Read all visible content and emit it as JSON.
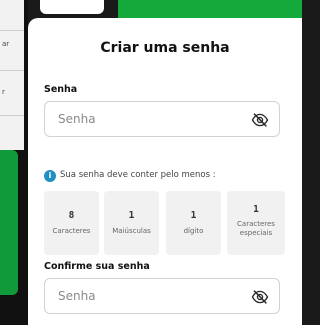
{
  "background": {
    "left_texts": [
      "ar",
      "r"
    ]
  },
  "sheet": {
    "title": "Criar uma senha",
    "password": {
      "label": "Senha",
      "placeholder": "Senha"
    },
    "hint": "Sua senha deve conter pelo menos :",
    "requirements": [
      {
        "value": "8",
        "label": "Caracteres"
      },
      {
        "value": "1",
        "label": "Maiúsculas"
      },
      {
        "value": "1",
        "label": "dígito"
      },
      {
        "value": "1",
        "label": "Caracteres especiais"
      }
    ],
    "confirm": {
      "label": "Confirme sua senha",
      "placeholder": "Senha"
    }
  },
  "colors": {
    "brand_green": "#15a93c",
    "info_blue": "#1f8fc4"
  }
}
